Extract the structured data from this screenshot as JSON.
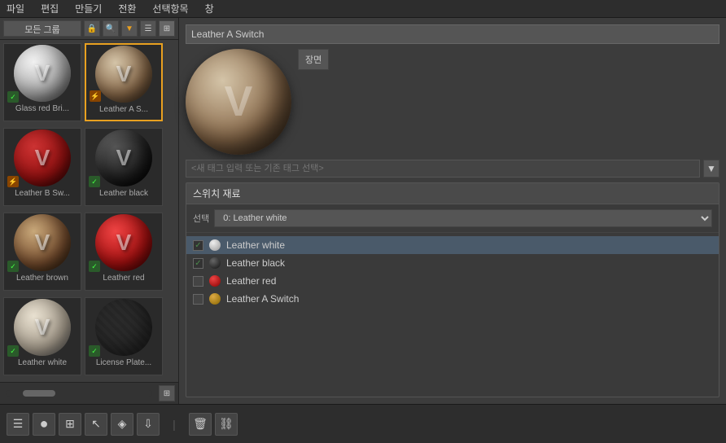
{
  "menu": {
    "items": [
      "파일",
      "편집",
      "만들기",
      "전환",
      "선택항목",
      "창"
    ]
  },
  "left_panel": {
    "group_label": "모든 그룹",
    "materials": [
      {
        "id": "glass-red-brick",
        "label": "Glass red Bri...",
        "type": "glass-white",
        "badge": "check"
      },
      {
        "id": "leather-a-switch",
        "label": "Leather A S...",
        "type": "leather-a",
        "badge": "orange",
        "selected": true
      },
      {
        "id": "leather-b-switch",
        "label": "Leather B Sw...",
        "type": "leather-b",
        "badge": "orange"
      },
      {
        "id": "leather-black",
        "label": "Leather black",
        "type": "leather-black",
        "badge": "check"
      },
      {
        "id": "leather-brown",
        "label": "Leather brown",
        "type": "leather-brown",
        "badge": "check"
      },
      {
        "id": "leather-red",
        "label": "Leather red",
        "type": "leather-red",
        "badge": "check"
      },
      {
        "id": "leather-white",
        "label": "Leather white",
        "type": "leather-white2",
        "badge": "check"
      },
      {
        "id": "license-plate",
        "label": "License Plate...",
        "type": "license",
        "badge": "check"
      }
    ]
  },
  "right_panel": {
    "material_name": "Leather A Switch",
    "scene_label": "장면",
    "tag_placeholder": "<새 태그 입력 또는 기존 태그 선택>",
    "switch_panel": {
      "title": "스위치 재료",
      "select_label": "선택",
      "select_value": "0: Leather white",
      "materials": [
        {
          "id": "leather-white",
          "name": "Leather white",
          "checked": true,
          "type": "white"
        },
        {
          "id": "leather-black",
          "name": "Leather black",
          "checked": true,
          "type": "black"
        },
        {
          "id": "leather-red",
          "name": "Leather red",
          "checked": false,
          "type": "red"
        },
        {
          "id": "leather-a-switch",
          "name": "Leather A Switch",
          "checked": false,
          "type": "switch"
        }
      ]
    }
  },
  "bottom_toolbar": {
    "buttons": [
      {
        "id": "menu-btn",
        "icon": "☰"
      },
      {
        "id": "circle-btn",
        "icon": "●"
      },
      {
        "id": "grid-btn",
        "icon": "▦"
      },
      {
        "id": "cursor-btn",
        "icon": "↖"
      },
      {
        "id": "paint-btn",
        "icon": "◈"
      },
      {
        "id": "divider1",
        "icon": "|"
      },
      {
        "id": "delete-btn",
        "icon": "🗑"
      },
      {
        "id": "chain-btn",
        "icon": "⛓"
      }
    ]
  }
}
